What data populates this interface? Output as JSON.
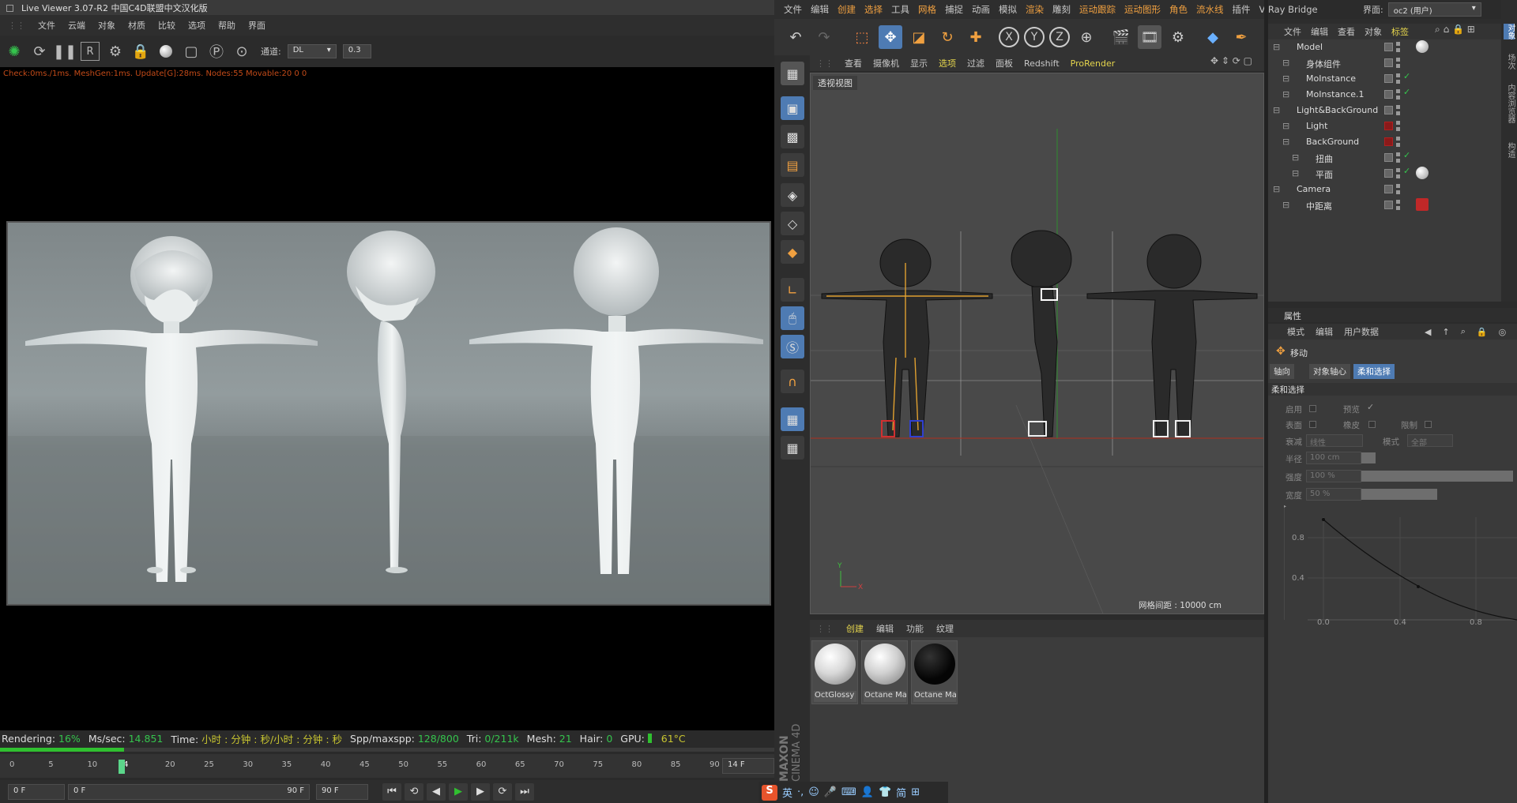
{
  "live_viewer": {
    "title": "Live Viewer 3.07-R2 中国C4D联盟中文汉化版",
    "menu": [
      "文件",
      "云端",
      "对象",
      "材质",
      "比较",
      "选项",
      "帮助",
      "界面"
    ],
    "channel_label": "通道:",
    "channel_value": "DL",
    "channel_number": "0.3",
    "status_line": "Check:0ms./1ms. MeshGen:1ms. Update[G]:28ms. Nodes:55 Movable:20  0 0",
    "stats": {
      "rendering_label": "Rendering:",
      "rendering_value": "16%",
      "ms_label": "Ms/sec:",
      "ms_value": "14.851",
      "time_label": "Time:",
      "time_value": "小时 : 分钟 : 秒/小时 : 分钟 : 秒",
      "spp_label": "Spp/maxspp:",
      "spp_value": "128/800",
      "tri_label": "Tri:",
      "tri_value": "0/211k",
      "mesh_label": "Mesh:",
      "mesh_value": "21",
      "hair_label": "Hair:",
      "hair_value": "0",
      "gpu_label": "GPU:",
      "gpu_temp": "61°C"
    },
    "progress": 0.16
  },
  "timeline": {
    "ticks": [
      "0",
      "5",
      "10",
      "14",
      "20",
      "25",
      "30",
      "35",
      "40",
      "45",
      "50",
      "55",
      "60",
      "65",
      "70",
      "75",
      "80",
      "85",
      "90"
    ],
    "current_frame": "14 F",
    "start_field": "0 F",
    "range_start": "0 F",
    "range_end": "90 F",
    "end_field": "90 F"
  },
  "c4d": {
    "menu": [
      "文件",
      "编辑",
      "创建",
      "选择",
      "工具",
      "网格",
      "捕捉",
      "动画",
      "模拟",
      "渲染",
      "雕刻",
      "运动跟踪",
      "运动图形",
      "角色",
      "流水线",
      "插件",
      "V-Ray Bridge"
    ],
    "menu_highlight": [
      "创建",
      "选择",
      "网格",
      "渲染",
      "运动跟踪",
      "运动图形",
      "角色",
      "流水线"
    ],
    "layout_label": "界面:",
    "layout_value": "oc2 (用户)",
    "viewport_menu": [
      "查看",
      "摄像机",
      "显示",
      "选项",
      "过滤",
      "面板",
      "Redshift",
      "ProRender"
    ],
    "viewport_label": "透视视图",
    "grid_text": "网格间距 : 10000 cm",
    "material_menu": [
      "创建",
      "编辑",
      "功能",
      "纹理"
    ],
    "materials": [
      {
        "name": "OctGlossy",
        "color": "#d8d8d8"
      },
      {
        "name": "Octane Ma",
        "color": "#d0d0d0"
      },
      {
        "name": "Octane Ma",
        "color": "#050505"
      }
    ],
    "brand_small": "MAXON",
    "brand_big": "CINEMA 4D"
  },
  "objects": {
    "menu": [
      "文件",
      "编辑",
      "查看",
      "对象",
      "标签"
    ],
    "items": [
      {
        "label": "Model",
        "indent": 0,
        "check": false
      },
      {
        "label": "身体组件",
        "indent": 1,
        "check": false
      },
      {
        "label": "MoInstance",
        "indent": 1,
        "check": true
      },
      {
        "label": "MoInstance.1",
        "indent": 1,
        "check": true
      },
      {
        "label": "Light&BackGround",
        "indent": 0,
        "check": false
      },
      {
        "label": "Light",
        "indent": 1,
        "check": false
      },
      {
        "label": "BackGround",
        "indent": 1,
        "check": false
      },
      {
        "label": "扭曲",
        "indent": 2,
        "check": true
      },
      {
        "label": "平面",
        "indent": 2,
        "check": true
      },
      {
        "label": "Camera",
        "indent": 0,
        "check": false
      },
      {
        "label": "中距离",
        "indent": 1,
        "check": false
      }
    ],
    "right_tabs": [
      "对象",
      "场次",
      "内容浏览器",
      "构造"
    ]
  },
  "attributes": {
    "title": "属性",
    "menu": [
      "模式",
      "编辑",
      "用户数据"
    ],
    "tool_name": "移动",
    "tabs": [
      "轴向",
      "对象轴心",
      "柔和选择"
    ],
    "section": "柔和选择",
    "enable_label": "启用",
    "preview_label": "预览",
    "surface_label": "表面",
    "rubber_label": "橡皮",
    "limit_label": "限制",
    "falloff_label": "衰减",
    "falloff_value": "线性",
    "mode_label": "模式",
    "mode_value": "全部",
    "radius_label": "半径",
    "radius_value": "100 cm",
    "strength_label": "强度",
    "strength_value": "100 %",
    "width_label": "宽度",
    "width_value": "50 %",
    "curve_y": [
      "0.8",
      "0.4"
    ],
    "curve_x": [
      "0.0",
      "0.4",
      "0.8"
    ]
  },
  "taskbar": {
    "ime_letter": "英",
    "ime_simplified": "简"
  },
  "colors": {
    "accent_blue": "#4e7bb3",
    "accent_orange": "#f0a040",
    "accent_green": "#35c44d",
    "status_red": "#c24a18"
  }
}
